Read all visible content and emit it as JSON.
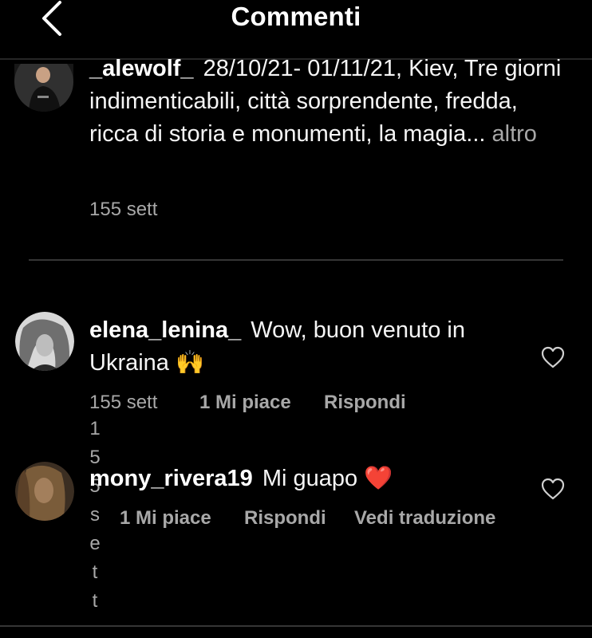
{
  "header": {
    "title": "Commenti"
  },
  "caption": {
    "username": "_alewolf_",
    "text": "28/10/21- 01/11/21, Kiev, Tre giorni indimenticabili, città sorprendente, fredda, ricca di storia e monumenti, la magia...",
    "more": "altro",
    "time": "155 sett"
  },
  "comments": [
    {
      "username": "elena_lenina_",
      "text": "Wow, buon venuto in Ukraina 🙌",
      "time": "155 sett",
      "likes": "1 Mi piace",
      "reply": "Rispondi"
    },
    {
      "username": "mony_rivera19",
      "text": "Mi guapo ❤️",
      "time_chars": [
        "1",
        "5",
        "5",
        "s",
        "e",
        "t",
        "t"
      ],
      "likes": "1 Mi piace",
      "reply": "Rispondi",
      "translate": "Vedi traduzione"
    }
  ],
  "icons": {
    "back": "chevron-left-icon",
    "like": "heart-outline-icon"
  },
  "colors": {
    "background": "#000000",
    "text": "#ffffff",
    "secondary_text": "#a8a8a8",
    "divider": "#363636"
  }
}
